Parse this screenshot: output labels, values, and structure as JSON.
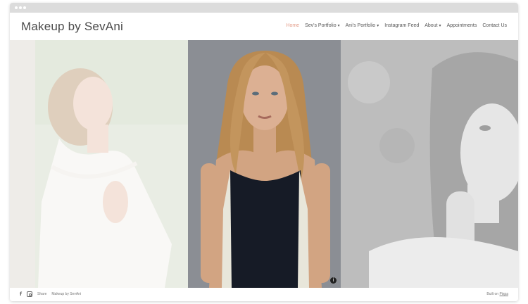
{
  "site": {
    "brand": "Makeup by SevAni"
  },
  "nav": [
    {
      "label": "Home",
      "active": true,
      "dropdown": false
    },
    {
      "label": "Sev's Portfolio",
      "active": false,
      "dropdown": true
    },
    {
      "label": "Ani's Portfolio",
      "active": false,
      "dropdown": true
    },
    {
      "label": "Instagram Feed",
      "active": false,
      "dropdown": false
    },
    {
      "label": "About",
      "active": false,
      "dropdown": true
    },
    {
      "label": "Appointments",
      "active": false,
      "dropdown": false
    },
    {
      "label": "Contact Us",
      "active": false,
      "dropdown": false
    }
  ],
  "footer": {
    "share": "Share",
    "site_name": "Makeup by SevAni",
    "built_on": "Built on",
    "builder": "Pixpa"
  },
  "icons": {
    "facebook": "facebook-icon",
    "instagram": "instagram-icon",
    "info": "info-icon",
    "caret": "chevron-down-icon"
  },
  "colors": {
    "accent": "#e39a86",
    "text": "#4a4a4a",
    "dress_black": "#161b26",
    "backdrop": "#8b8e94"
  }
}
